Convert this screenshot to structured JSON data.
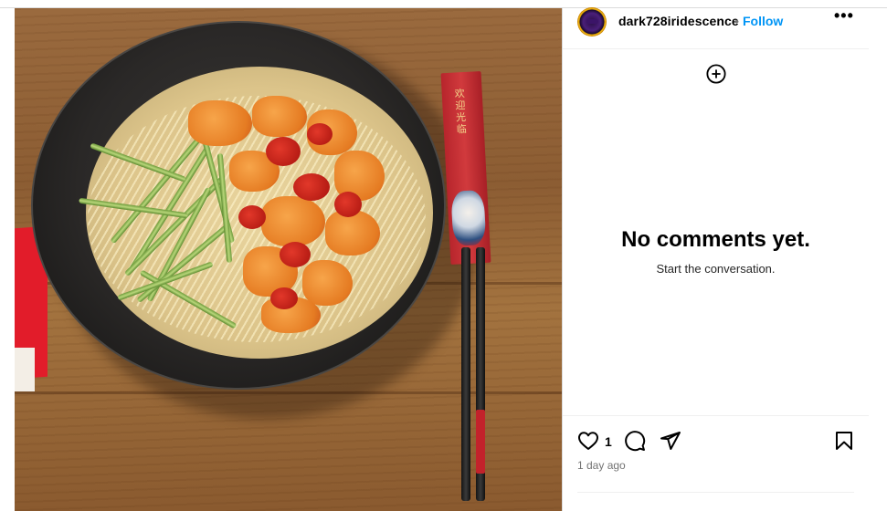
{
  "post": {
    "username": "dark728iridescence",
    "separator": "•",
    "follow_label": "Follow",
    "more_label": "•••",
    "like_count": "1",
    "timestamp": "1 day ago"
  },
  "comments": {
    "empty_title": "No comments yet.",
    "empty_subtitle": "Start the conversation."
  },
  "photo": {
    "sleeve_text": "欢迎光临"
  },
  "icons": {
    "add": "plus-circle-icon",
    "like": "heart-icon",
    "comment": "comment-icon",
    "share": "send-icon",
    "save": "bookmark-icon",
    "more": "more-horizontal-icon"
  },
  "colors": {
    "follow": "#0095f6",
    "secondary_text": "#737373",
    "divider": "#dbdbdb"
  }
}
